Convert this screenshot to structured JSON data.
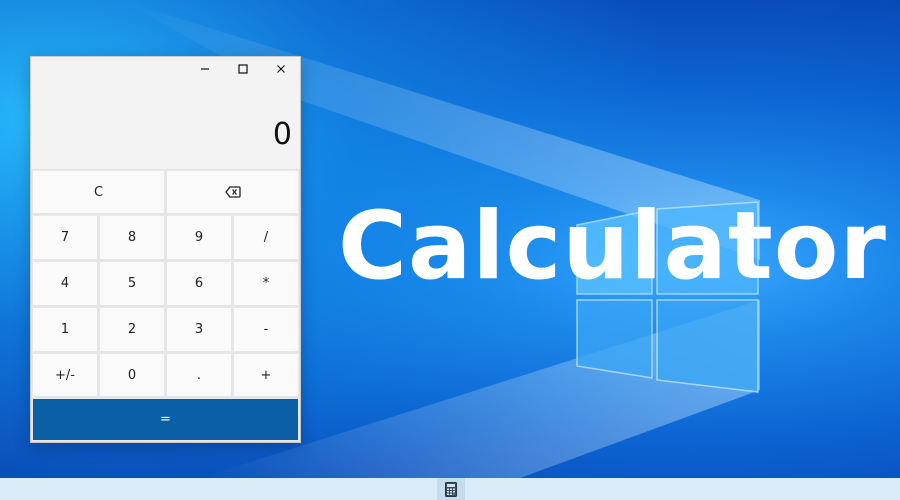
{
  "hero": {
    "title": "Calculator"
  },
  "window": {
    "controls": {
      "minimize_icon": "minimize-icon",
      "maximize_icon": "maximize-icon",
      "close_icon": "close-icon"
    }
  },
  "display": {
    "value": "0"
  },
  "keys": {
    "row1": [
      "C",
      "backspace-icon"
    ],
    "row2": [
      "7",
      "8",
      "9",
      "/"
    ],
    "row3": [
      "4",
      "5",
      "6",
      "*"
    ],
    "row4": [
      "1",
      "2",
      "3",
      "-"
    ],
    "row5": [
      "+/-",
      "0",
      ".",
      "+"
    ],
    "equals": "="
  },
  "labels": {
    "c": "C",
    "k7": "7",
    "k8": "8",
    "k9": "9",
    "div": "/",
    "k4": "4",
    "k5": "5",
    "k6": "6",
    "mul": "*",
    "k1": "1",
    "k2": "2",
    "k3": "3",
    "sub": "-",
    "neg": "+/-",
    "k0": "0",
    "dot": ".",
    "add": "+",
    "eq": "="
  },
  "colors": {
    "equals_key": "#0b5fa5",
    "key_bg": "#fafafa",
    "desktop_accent": "#1b86ea"
  },
  "taskbar": {
    "app_icon": "calculator-icon"
  }
}
